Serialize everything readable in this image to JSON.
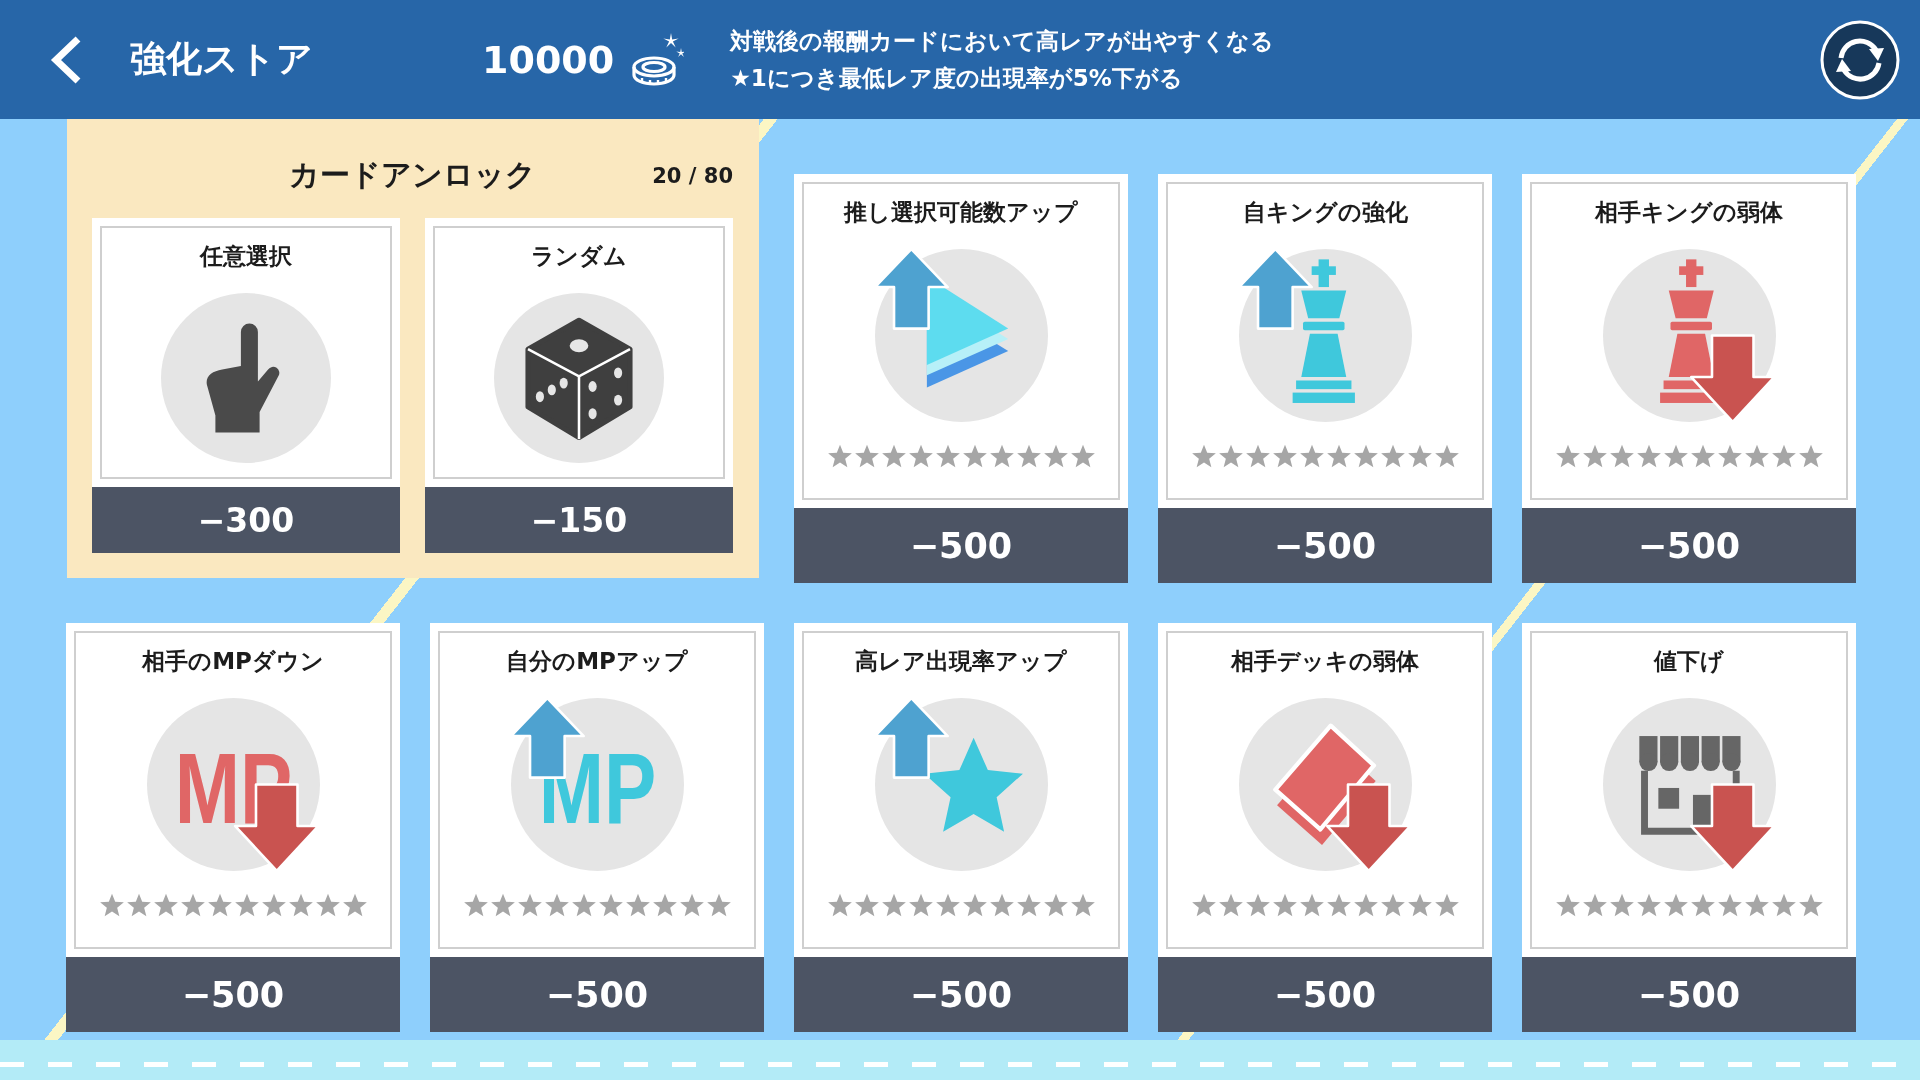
{
  "header": {
    "title": "強化ストア",
    "coins": "10000",
    "description": [
      "対戦後の報酬カードにおいて高レアが出やすくなる",
      "★1につき最低レア度の出現率が5%下がる"
    ]
  },
  "unlock_panel": {
    "title": "カードアンロック",
    "count": "20 / 80",
    "options": [
      {
        "name": "任意選択",
        "price": "−300"
      },
      {
        "name": "ランダム",
        "price": "−150"
      }
    ]
  },
  "upgrades": [
    {
      "name": "推し選択可能数アップ",
      "stars": 0,
      "price": "−500"
    },
    {
      "name": "自キングの強化",
      "stars": 0,
      "price": "−500"
    },
    {
      "name": "相手キングの弱体",
      "stars": 0,
      "price": "−500"
    },
    {
      "name": "相手のMPダウン",
      "icon_text": "MP",
      "stars": 0,
      "price": "−500"
    },
    {
      "name": "自分のMPアップ",
      "icon_text": "MP",
      "stars": 0,
      "price": "−500"
    },
    {
      "name": "高レア出現率アップ",
      "stars": 0,
      "price": "−500"
    },
    {
      "name": "相手デッキの弱体",
      "stars": 0,
      "price": "−500"
    },
    {
      "name": "値下げ",
      "stars": 0,
      "price": "−500"
    }
  ]
}
